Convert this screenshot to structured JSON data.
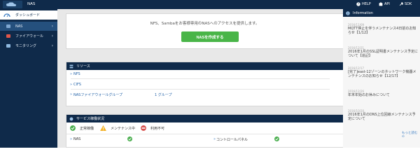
{
  "header": {
    "title": "NAS",
    "help": "HELP",
    "api": "API",
    "sdk": "SDK"
  },
  "sidebar": {
    "dashboard": "ダッシュボード",
    "items": [
      {
        "label": "NAS"
      },
      {
        "label": "ファイアウォール"
      },
      {
        "label": "モニタリング"
      }
    ]
  },
  "banner": {
    "message": "NFS、Sambaをお客様専用のNASへのアクセスを提供します。",
    "button": "NASを作成する"
  },
  "resources": {
    "title": "リソース",
    "items": [
      "NFS",
      "CIFS",
      "NASファイアウォールグループ"
    ],
    "group_count": "1 グループ"
  },
  "service_status": {
    "title": "サービス稼働状況",
    "legend": [
      {
        "label": "正常稼働",
        "icon": "check-icon",
        "color": "#4caf50"
      },
      {
        "label": "メンテナンス中",
        "icon": "warning-icon",
        "color": "#f3b32a"
      },
      {
        "label": "利用不可",
        "icon": "stop-icon",
        "color": "#d9534f"
      }
    ],
    "services": [
      {
        "label": "NAS",
        "status": "ok"
      },
      {
        "label": "コントロールパネル",
        "status": "ok"
      }
    ]
  },
  "information": {
    "title": "Information",
    "news": [
      {
        "date": "2016/11/09",
        "title": "MQTT停止を伴うメンテナンス4日前のお知らせ【1/12】"
      },
      {
        "date": "2016/12/21",
        "title": "2016年1月のSSL証明書メンテナンス予定について【追記】"
      },
      {
        "date": "2016/12/17",
        "title": "[完了]east-12ゾーンのネットワーク機器メンテナンスのお知らせ【12/17】"
      },
      {
        "date": "2016/12/26",
        "title": "年末年始のお休みについて"
      },
      {
        "date": "2016/10/20",
        "title": "2016年1月のDNS上位回線メンテナンス予定について"
      }
    ],
    "more": "もっと読む"
  },
  "colors": {
    "navy": "#0f2a4a",
    "green": "#49b548",
    "accent": "#3b7cc2"
  }
}
